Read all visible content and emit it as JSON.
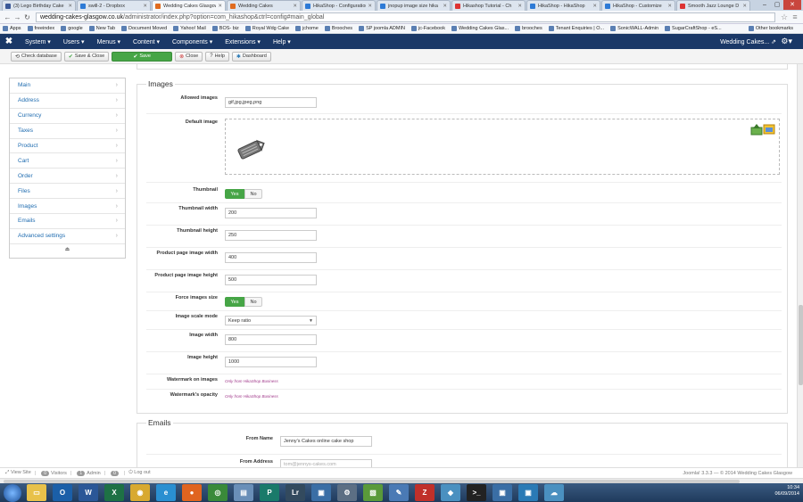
{
  "browser": {
    "tabs": [
      {
        "label": "(3) Lego Birthday Cake",
        "color": "#3b5998"
      },
      {
        "label": "swill-2 - Dropbox",
        "color": "#2d7ad6"
      },
      {
        "label": "Wedding Cakes Glasgow",
        "color": "#e06b1f",
        "active": true
      },
      {
        "label": "Wedding Cakes",
        "color": "#e06b1f"
      },
      {
        "label": "HikaShop - Configuration",
        "color": "#2d7ad6"
      },
      {
        "label": "jnopup image size hika",
        "color": "#2d7ad6"
      },
      {
        "label": "Hikashop Tutorial - Ch",
        "color": "#d33"
      },
      {
        "label": "HikaShop - HikaShop",
        "color": "#2d7ad6"
      },
      {
        "label": "HikaShop - Customize",
        "color": "#2d7ad6"
      },
      {
        "label": "Smooth Jazz Lounge D",
        "color": "#d33"
      }
    ],
    "url_host": "wedding-cakes-glasgow.co.uk",
    "url_path": "/administrator/index.php?option=com_hikashop&ctrl=config#main_global",
    "bookmarks": [
      "Apps",
      "freeindex",
      "google",
      "New Tab",
      "Document Moved",
      "Yahoo! Mail",
      "BOS- biz",
      "Royal Wdg Cake",
      "jchome",
      "Brooches",
      "SP joomla ADMIN",
      "jc-Facebook",
      "Wedding Cakes Glas...",
      "brooches",
      "Tenant Enquiries | O...",
      "SonicWALL-Admin",
      "SugarCraftShop - eS..."
    ],
    "other_bookmarks": "Other bookmarks"
  },
  "admin_menu": {
    "items": [
      "System",
      "Users",
      "Menus",
      "Content",
      "Components",
      "Extensions",
      "Help"
    ],
    "site_name": "Wedding Cakes..."
  },
  "toolbar": {
    "check_db": "Check database",
    "save_close": "Save & Close",
    "save": "Save",
    "close": "Close",
    "help": "Help",
    "dashboard": "Dashboard"
  },
  "sidebar": {
    "items": [
      "Main",
      "Address",
      "Currency",
      "Taxes",
      "Product",
      "Cart",
      "Order",
      "Files",
      "Images",
      "Emails",
      "Advanced settings"
    ]
  },
  "images": {
    "legend": "Images",
    "allowed_label": "Allowed images",
    "allowed_value": "gif,jpg,jpeg,png",
    "default_label": "Default image",
    "thumbnail_label": "Thumbnail",
    "yes": "Yes",
    "no": "No",
    "thumb_width_label": "Thumbnail width",
    "thumb_width": "200",
    "thumb_height_label": "Thumbnail height",
    "thumb_height": "250",
    "pp_width_label": "Product page image width",
    "pp_width": "400",
    "pp_height_label": "Product page image height",
    "pp_height": "500",
    "force_label": "Force images size",
    "scale_label": "Image scale mode",
    "scale_value": "Keep ratio",
    "img_width_label": "Image width",
    "img_width": "800",
    "img_height_label": "Image height",
    "img_height": "1000",
    "watermark_label": "Watermark on images",
    "watermark_opacity_label": "Watermark's opacity",
    "business_only": "Only from HikaShop Business"
  },
  "emails": {
    "legend": "Emails",
    "from_name_label": "From Name",
    "from_name": "Jenny's Cakes online cake shop",
    "from_address_label": "From Address",
    "from_address": "tom@jennys-cakes.com"
  },
  "statusbar": {
    "view_site": "View Site",
    "visitors_count": "0",
    "visitors": "Visitors",
    "admin_count": "1",
    "admin": "Admin",
    "messages_count": "0",
    "logout": "Log out",
    "footer": "Joomla! 3.3.3 — © 2014 Wedding Cakes Glasgow"
  },
  "taskbar": {
    "time": "10:34",
    "date": "06/09/2014",
    "apps": [
      {
        "name": "explorer",
        "color": "#e8c14a",
        "glyph": "▭"
      },
      {
        "name": "outlook",
        "color": "#1b5fa8",
        "glyph": "O"
      },
      {
        "name": "word",
        "color": "#2b5797",
        "glyph": "W"
      },
      {
        "name": "excel",
        "color": "#1e7145",
        "glyph": "X"
      },
      {
        "name": "chrome",
        "color": "#d8a930",
        "glyph": "◉"
      },
      {
        "name": "ie",
        "color": "#2a8fd1",
        "glyph": "e"
      },
      {
        "name": "firefox",
        "color": "#e0641f",
        "glyph": "●"
      },
      {
        "name": "ccleaner",
        "color": "#3a8a3a",
        "glyph": "◎"
      },
      {
        "name": "notepad",
        "color": "#6a8fb8",
        "glyph": "▤"
      },
      {
        "name": "publisher",
        "color": "#1a7a6a",
        "glyph": "P"
      },
      {
        "name": "lightroom",
        "color": "#334a5e",
        "glyph": "Lr"
      },
      {
        "name": "app12",
        "color": "#3a6ea5",
        "glyph": "▣"
      },
      {
        "name": "settings",
        "color": "#5c6f84",
        "glyph": "⚙"
      },
      {
        "name": "photos",
        "color": "#5a9a3a",
        "glyph": "▧"
      },
      {
        "name": "paint",
        "color": "#4a7ab5",
        "glyph": "✎"
      },
      {
        "name": "filezilla",
        "color": "#c0302a",
        "glyph": "Z"
      },
      {
        "name": "app17",
        "color": "#4a90c0",
        "glyph": "◆"
      },
      {
        "name": "cmd",
        "color": "#222222",
        "glyph": ">_"
      },
      {
        "name": "app19",
        "color": "#3a6ea5",
        "glyph": "▣"
      },
      {
        "name": "app20",
        "color": "#2a7ab5",
        "glyph": "▣"
      },
      {
        "name": "app21",
        "color": "#4a90c0",
        "glyph": "☁"
      }
    ]
  },
  "colors": {
    "admin_bar": "#1a3867",
    "green": "#46a546",
    "link": "#1f6cb0"
  }
}
